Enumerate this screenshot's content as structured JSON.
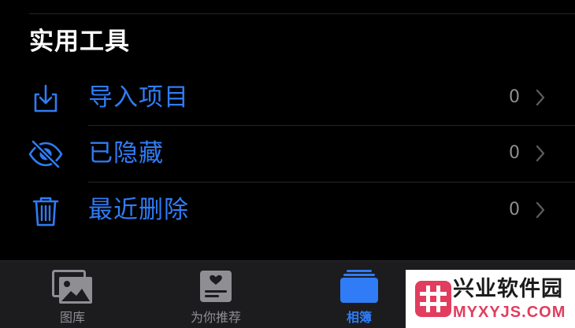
{
  "section": {
    "title": "实用工具"
  },
  "rows": [
    {
      "label": "导入项目",
      "count": "0",
      "icon": "import-icon"
    },
    {
      "label": "已隐藏",
      "count": "0",
      "icon": "hidden-eye-icon"
    },
    {
      "label": "最近删除",
      "count": "0",
      "icon": "trash-icon"
    }
  ],
  "tabs": [
    {
      "label": "图库",
      "icon": "photo-library-icon",
      "active": false
    },
    {
      "label": "为你推荐",
      "icon": "for-you-icon",
      "active": false
    },
    {
      "label": "相簿",
      "icon": "albums-icon",
      "active": true
    }
  ],
  "watermark": {
    "title": "兴业软件园",
    "url": "MYXYJS.COM"
  },
  "colors": {
    "accent": "#2f7cf6",
    "background": "#000000",
    "tabbar": "#1c1c1e",
    "secondary_text": "#8e8e93",
    "watermark_brand": "#e23d5e"
  }
}
